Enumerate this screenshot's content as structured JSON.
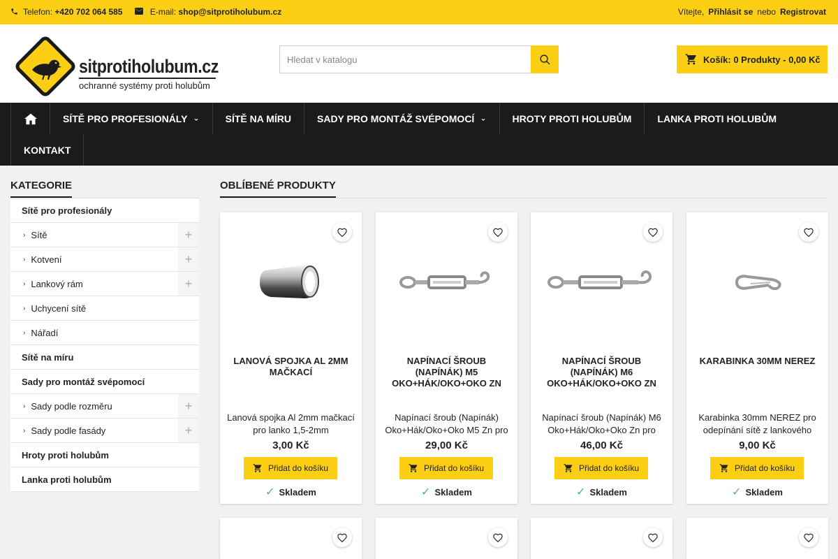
{
  "topbar": {
    "phone_label": "Telefon:",
    "phone_value": "+420 702 064 585",
    "email_label": "E-mail:",
    "email_value": "shop@sitprotiholubum.cz",
    "welcome": "Vítejte,",
    "login": "Přihlásit se",
    "or": "nebo",
    "register": "Registrovat"
  },
  "logo": {
    "name": "sitprotiholubum.cz",
    "tagline": "ochranné systémy proti holubům"
  },
  "search": {
    "placeholder": "Hledat v katalogu"
  },
  "cart": {
    "label": "Košík: 0 Produkty - 0,00 Kč"
  },
  "nav": {
    "items": [
      {
        "label": "Sítě pro profesionály",
        "has_sub": true
      },
      {
        "label": "Sítě na míru",
        "has_sub": false
      },
      {
        "label": "Sady pro montáž svépomocí",
        "has_sub": true
      },
      {
        "label": "Hroty proti holubům",
        "has_sub": false
      },
      {
        "label": "Lanka proti holubům",
        "has_sub": false
      },
      {
        "label": "Kontakt",
        "has_sub": false
      }
    ]
  },
  "sidebar": {
    "title": "Kategorie",
    "items": [
      {
        "label": "Sítě pro profesionály",
        "level": 1
      },
      {
        "label": "Sítě",
        "level": 2,
        "expandable": true
      },
      {
        "label": "Kotvení",
        "level": 2,
        "expandable": true
      },
      {
        "label": "Lankový rám",
        "level": 2,
        "expandable": true
      },
      {
        "label": "Uchycení sítě",
        "level": 2,
        "expandable": false
      },
      {
        "label": "Nářadí",
        "level": 2,
        "expandable": false
      },
      {
        "label": "Sítě na míru",
        "level": 1
      },
      {
        "label": "Sady pro montáž svépomocí",
        "level": 1
      },
      {
        "label": "Sady podle rozměru",
        "level": 2,
        "expandable": true
      },
      {
        "label": "Sady podle fasády",
        "level": 2,
        "expandable": true
      },
      {
        "label": "Hroty proti holubům",
        "level": 1
      },
      {
        "label": "Lanka proti holubům",
        "level": 1
      }
    ]
  },
  "content": {
    "title": "Oblíbené produkty",
    "add_to_cart": "Přidat do košíku",
    "in_stock": "Skladem",
    "products": [
      {
        "title": "Lanová spojka Al 2mm mačkací",
        "desc": "Lanová spojka Al 2mm mačkací pro lanko 1,5-2mm",
        "price": "3,00 Kč",
        "image": "sleeve"
      },
      {
        "title": "Napínací šroub (Napínák) M5 Oko+Hák/Oko+Oko Zn",
        "desc": "Napínací šroub (Napínák) Oko+Hák/Oko+Oko M5 Zn pro",
        "price": "29,00 Kč",
        "image": "turnbuckle"
      },
      {
        "title": "Napínací šroub (Napínák) M6 Oko+Hák/Oko+Oko Zn",
        "desc": "Napínací šroub (Napínák) M6 Oko+Hák/Oko+Oko Zn pro",
        "price": "46,00 Kč",
        "image": "turnbuckle"
      },
      {
        "title": "Karabinka 30mm nerez",
        "desc": "Karabinka 30mm NEREZ pro odepínání sítě z lankového",
        "price": "9,00 Kč",
        "image": "snap-hook"
      }
    ]
  },
  "colors": {
    "accent": "#fccf14",
    "nav_bg": "#1b1b1b",
    "stock_green": "#4cbb6c"
  }
}
